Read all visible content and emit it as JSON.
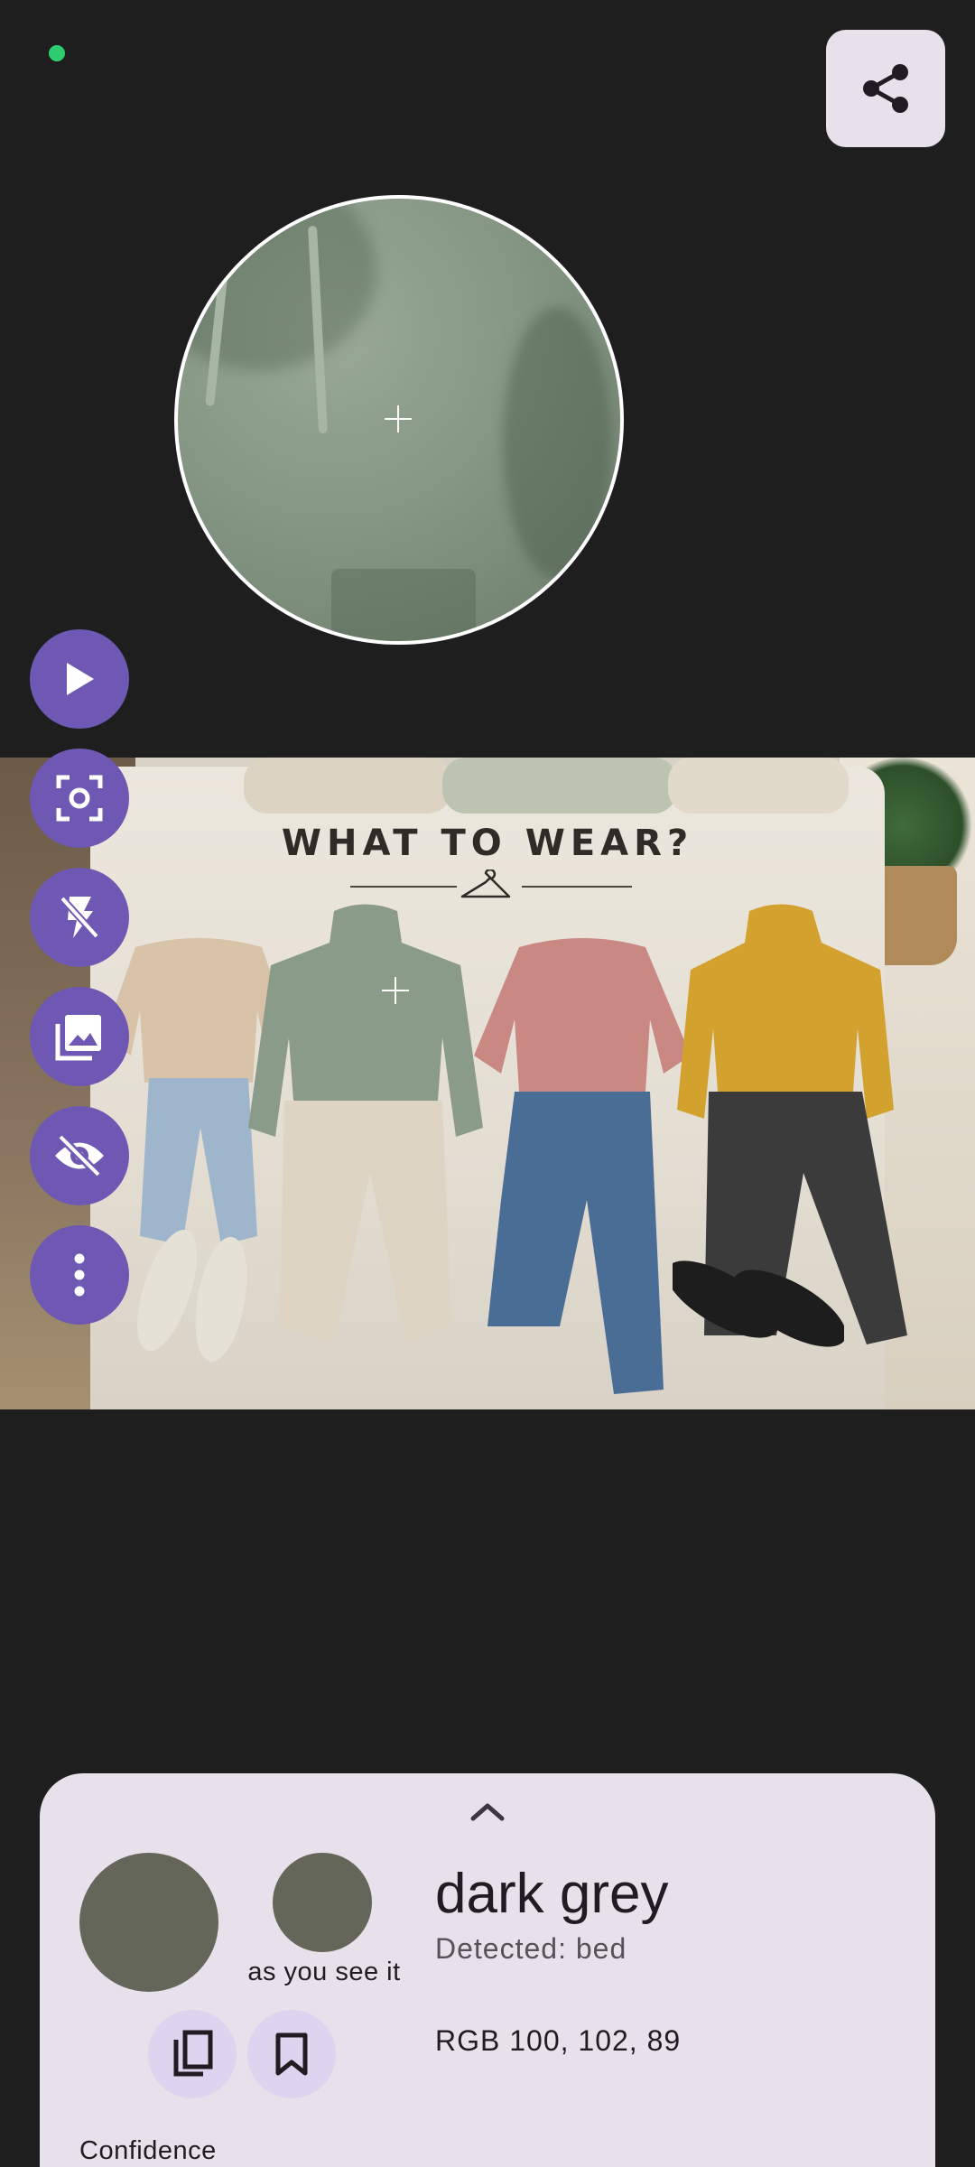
{
  "status": {
    "indicator_color": "#2ecc71"
  },
  "toolbar": {
    "share_icon": "share-icon"
  },
  "loupe": {
    "crosshair_icon": "crosshair-icon"
  },
  "photo": {
    "title": "WHAT TO WEAR?",
    "hanger_icon": "hanger-icon"
  },
  "fabs": [
    {
      "name": "play-button",
      "icon": "play-icon"
    },
    {
      "name": "focus-button",
      "icon": "focus-frame-icon"
    },
    {
      "name": "flash-off-button",
      "icon": "flash-off-icon"
    },
    {
      "name": "gallery-button",
      "icon": "photo-library-icon"
    },
    {
      "name": "hide-button",
      "icon": "visibility-off-icon"
    },
    {
      "name": "more-button",
      "icon": "more-vert-icon"
    }
  ],
  "sheet": {
    "expand_icon": "chevron-up-icon",
    "swatch_color": "#64665a",
    "seen_label": "as you see it",
    "color_name": "dark grey",
    "detected": "Detected: bed",
    "rgb": "RGB 100, 102, 89",
    "copy_icon": "copy-icon",
    "bookmark_icon": "bookmark-icon",
    "confidence_label": "Confidence"
  },
  "colors": {
    "background": "#1e1e1e",
    "fab": "#6e58b3",
    "sheet": "#e6e1ea",
    "icon_button": "#ddd4ef"
  }
}
